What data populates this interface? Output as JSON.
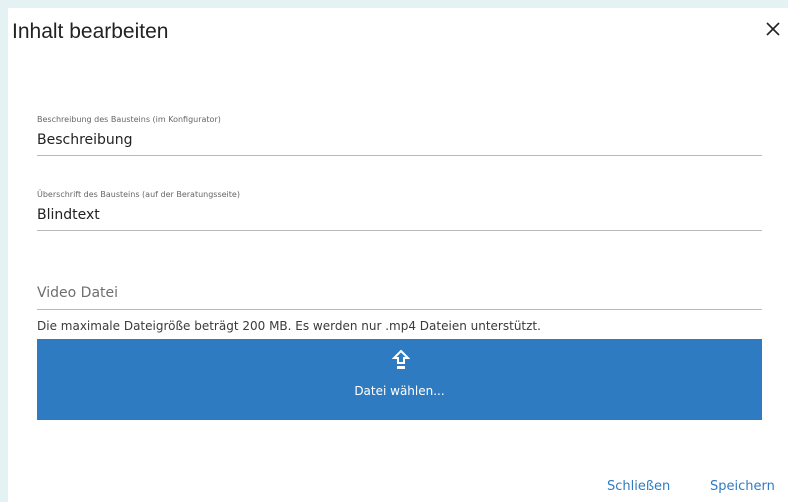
{
  "dialog": {
    "title": "Inhalt bearbeiten",
    "close_icon": "close-icon"
  },
  "fields": {
    "description": {
      "label": "Beschreibung des Bausteins (im Konfigurator)",
      "value": "Beschreibung"
    },
    "heading": {
      "label": "Überschrift des Bausteins (auf der Beratungsseite)",
      "value": "Blindtext"
    },
    "video": {
      "placeholder": "Video Datei"
    }
  },
  "upload": {
    "hint": "Die maximale Dateigröße beträgt 200 MB. Es werden nur .mp4 Dateien unterstützt.",
    "icon": "upload-icon",
    "button_label": "Datei wählen..."
  },
  "footer": {
    "close_label": "Schließen",
    "save_label": "Speichern"
  },
  "colors": {
    "accent": "#2f7bc1",
    "backdrop": "#e5f2f4"
  }
}
